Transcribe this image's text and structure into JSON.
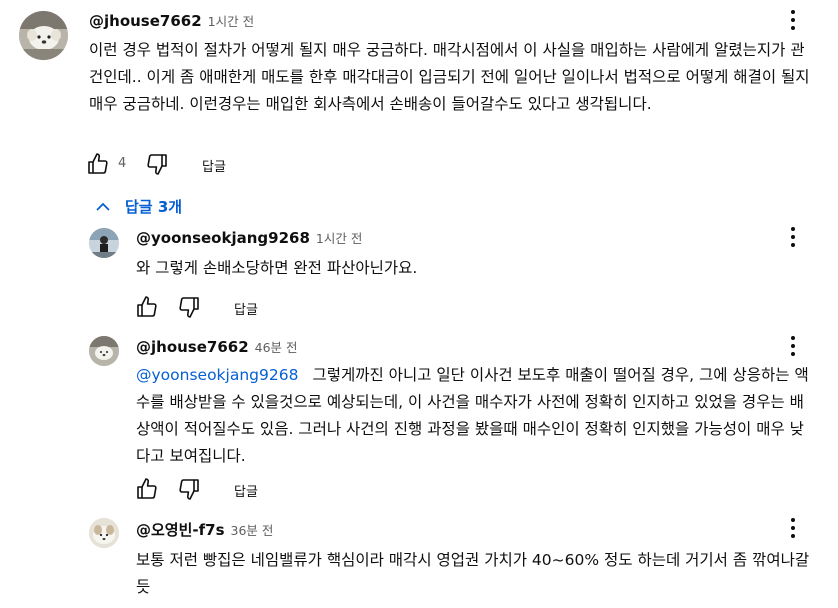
{
  "comment": {
    "handle": "@jhouse7662",
    "time": "1시간 전",
    "text": "이런 경우 법적이 절차가 어떻게 될지 매우 궁금하다. 매각시점에서 이 사실을 매입하는 사람에게 알렸는지가 관건인데.. 이게 좀 애매한게 매도를 한후 매각대금이 입금되기 전에 일어난 일이나서 법적으로 어떻게 해결이 될지 매우 궁금하네. 이런경우는 매입한 회사측에서 손배송이 들어갈수도 있다고 생각됩니다.",
    "likes": "4",
    "reply_label": "답글"
  },
  "replies_toggle": {
    "label": "답글 3개"
  },
  "replies": [
    {
      "handle": "@yoonseokjang9268",
      "time": "1시간 전",
      "mention": "",
      "text": "와 그렇게 손배소당하면 완전 파산아닌가요.",
      "reply_label": "답글"
    },
    {
      "handle": "@jhouse7662",
      "time": "46분 전",
      "mention": "@yoonseokjang9268",
      "text": "그렇게까진 아니고 일단 이사건 보도후 매출이 떨어질 경우, 그에 상응하는 액수를 배상받을 수 있을것으로 예상되는데, 이 사건을 매수자가 사전에 정확히 인지하고 있었을 경우는 배상액이 적어질수도 있음. 그러나 사건의 진행 과정을 봤을때 매수인이 정확히 인지했을 가능성이 매우 낮다고 보여집니다.",
      "reply_label": "답글"
    },
    {
      "handle": "@오영빈-f7s",
      "time": "36분 전",
      "mention": "",
      "text": "보통 저런 빵집은 네임밸류가 핵심이라 매각시 영업권 가치가 40~60% 정도 하는데 거기서 좀 깎여나갈듯",
      "reply_label": ""
    }
  ]
}
